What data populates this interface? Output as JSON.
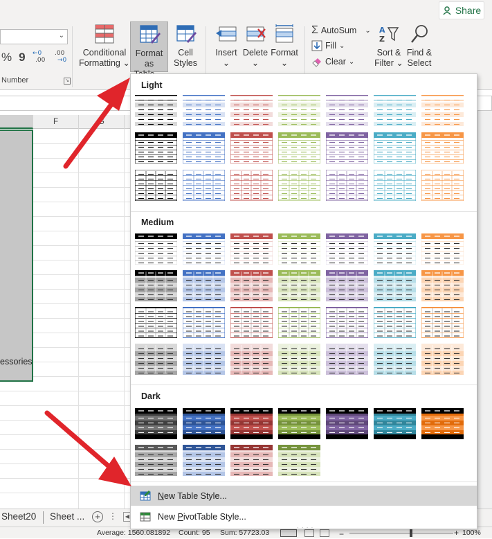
{
  "ribbon": {
    "share_label": "Share",
    "number_group_label": "Number",
    "number_symbols": [
      "%",
      "9"
    ],
    "buttons": {
      "conditional_formatting": [
        "Conditional",
        "Formatting ⌄"
      ],
      "format_as_table": [
        "Format as",
        "Table ⌄"
      ],
      "cell_styles": [
        "Cell",
        "Styles ⌄"
      ],
      "insert": [
        "Insert",
        "⌄"
      ],
      "delete": [
        "Delete",
        "⌄"
      ],
      "format": [
        "Format",
        "⌄"
      ],
      "sort_filter": [
        "Sort &",
        "Filter ⌄"
      ],
      "find_select": [
        "Find &",
        "Select ⌄"
      ]
    },
    "autosum_label": "AutoSum",
    "fill_label": "Fill",
    "clear_label": "Clear"
  },
  "sheet": {
    "columns": [
      "F",
      "G"
    ],
    "cell_text": "essories",
    "tabs": [
      "Sheet20",
      "Sheet ..."
    ]
  },
  "status": {
    "average": "Average: 1560.081892",
    "count": "Count: 95",
    "sum": "Sum: 57723.03",
    "zoom": "100%"
  },
  "menu": {
    "sections": {
      "light": "Light",
      "medium": "Medium",
      "dark": "Dark"
    },
    "new_table_style": {
      "u": "N",
      "rest": "ew Table Style..."
    },
    "new_pivot_style": {
      "pre": "New ",
      "u": "P",
      "rest": "ivotTable Style..."
    }
  },
  "colors": {
    "palette": [
      "#000000",
      "#4472c4",
      "#c0504d",
      "#9bbb59",
      "#8064a2",
      "#4bacc6",
      "#f79646"
    ],
    "excel_green": "#217346",
    "arrow_red": "#e0252b"
  }
}
